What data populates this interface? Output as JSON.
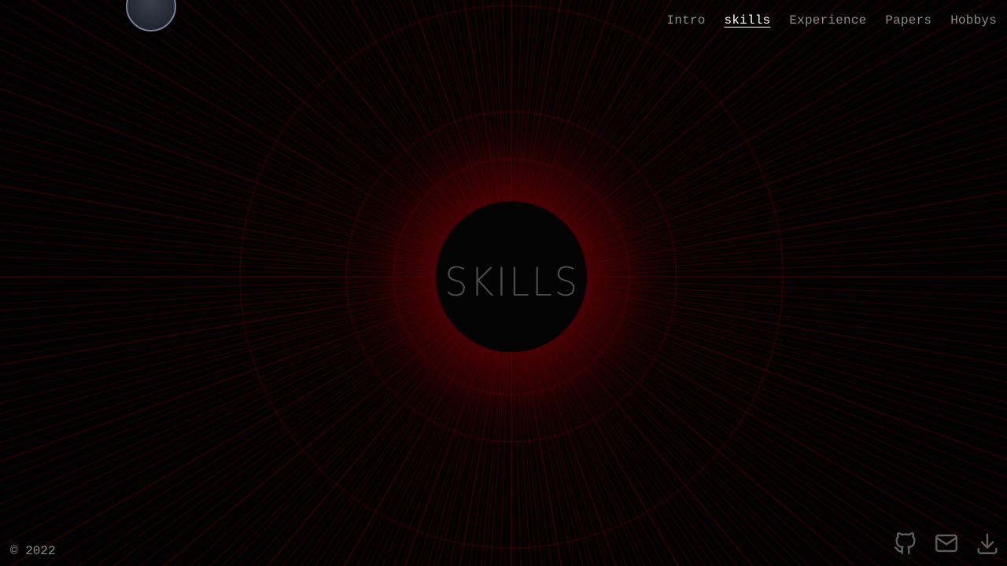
{
  "nav": {
    "items": [
      {
        "label": "Intro",
        "active": false
      },
      {
        "label": "skills",
        "active": true
      },
      {
        "label": "Experience",
        "active": false
      },
      {
        "label": "Papers",
        "active": false
      },
      {
        "label": "Hobbys",
        "active": false
      }
    ]
  },
  "hero": {
    "title": "SKILLS"
  },
  "footer": {
    "copyright": "© 2022"
  },
  "social": {
    "icons": [
      "github-icon",
      "mail-icon",
      "download-icon"
    ]
  },
  "theme": {
    "background": "#020202",
    "accent": "#7a0000",
    "nav_text": "#8c8c8c",
    "nav_active": "#ffffff",
    "title_text": "#4a4a4a"
  }
}
